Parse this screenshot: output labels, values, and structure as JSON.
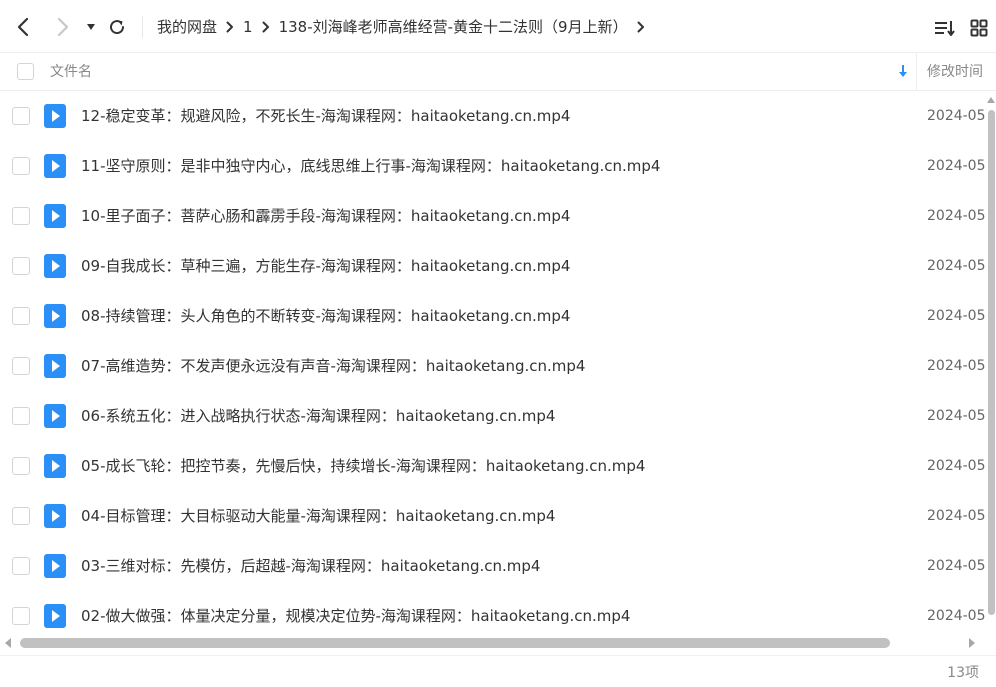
{
  "toolbar": {
    "breadcrumbs": [
      "我的网盘",
      "1",
      "138-刘海峰老师高维经营-黄金十二法则（9月上新）"
    ]
  },
  "header": {
    "name_label": "文件名",
    "mtime_label": "修改时间"
  },
  "files": [
    {
      "name": "12-稳定变革：规避风险，不死长生-海淘课程网：haitaoketang.cn.mp4",
      "date": "2024-05"
    },
    {
      "name": "11-坚守原则：是非中独守内心，底线思维上行事-海淘课程网：haitaoketang.cn.mp4",
      "date": "2024-05"
    },
    {
      "name": "10-里子面子：菩萨心肠和霹雳手段-海淘课程网：haitaoketang.cn.mp4",
      "date": "2024-05"
    },
    {
      "name": "09-自我成长：草种三遍，方能生存-海淘课程网：haitaoketang.cn.mp4",
      "date": "2024-05"
    },
    {
      "name": "08-持续管理：头人角色的不断转变-海淘课程网：haitaoketang.cn.mp4",
      "date": "2024-05"
    },
    {
      "name": "07-高维造势：不发声便永远没有声音-海淘课程网：haitaoketang.cn.mp4",
      "date": "2024-05"
    },
    {
      "name": "06-系统五化：进入战略执行状态-海淘课程网：haitaoketang.cn.mp4",
      "date": "2024-05"
    },
    {
      "name": "05-成长飞轮：把控节奏，先慢后快，持续增长-海淘课程网：haitaoketang.cn.mp4",
      "date": "2024-05"
    },
    {
      "name": "04-目标管理：大目标驱动大能量-海淘课程网：haitaoketang.cn.mp4",
      "date": "2024-05"
    },
    {
      "name": "03-三维对标：先模仿，后超越-海淘课程网：haitaoketang.cn.mp4",
      "date": "2024-05"
    },
    {
      "name": "02-做大做强：体量决定分量，规模决定位势-海淘课程网：haitaoketang.cn.mp4",
      "date": "2024-05"
    }
  ],
  "footer": {
    "count": "13项"
  },
  "colors": {
    "video_icon": "#2a8ff7",
    "divider": "#eeeeee",
    "scrollbar": "#c1c1c1"
  },
  "icons": [
    "back-icon",
    "forward-icon",
    "dropdown-icon",
    "refresh-icon",
    "chevron-right-icon",
    "sort-list-icon",
    "grid-view-icon",
    "sort-desc-arrow-icon",
    "video-file-icon"
  ]
}
